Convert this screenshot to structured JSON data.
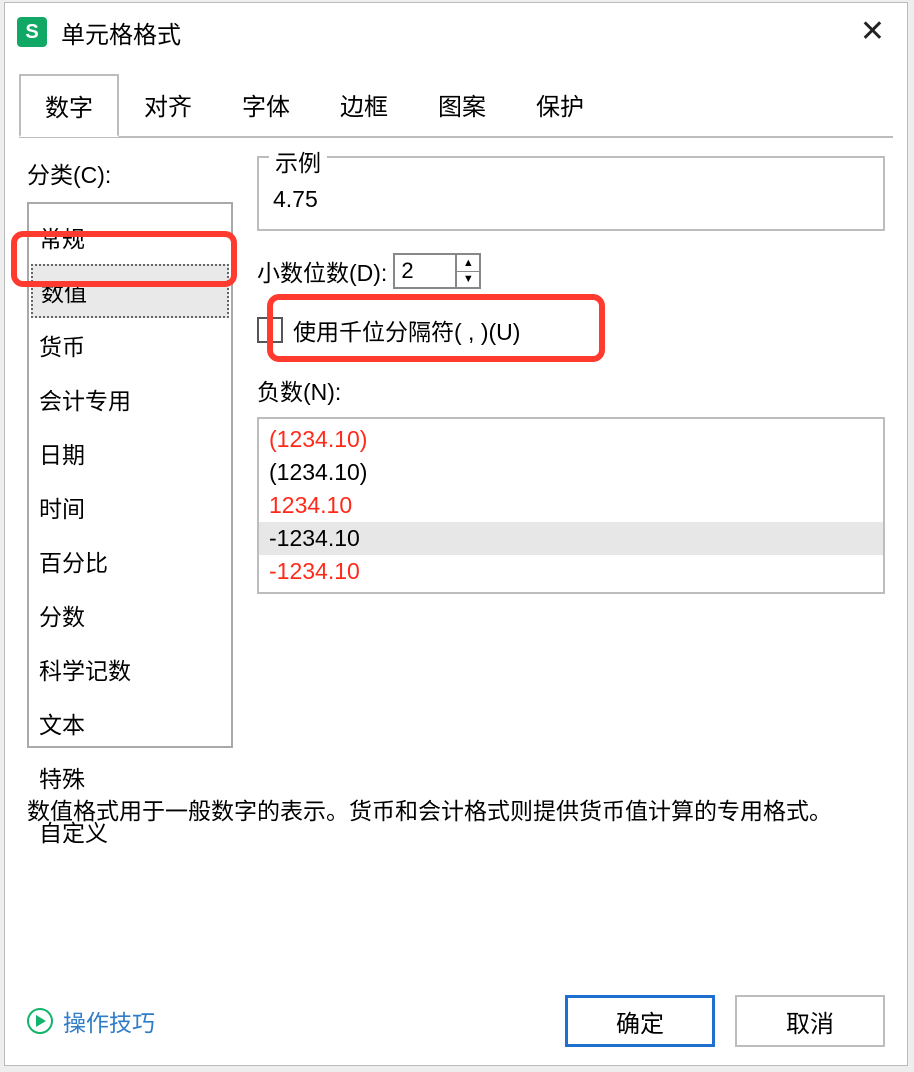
{
  "title": "单元格格式",
  "app_icon_letter": "S",
  "tabs": [
    "数字",
    "对齐",
    "字体",
    "边框",
    "图案",
    "保护"
  ],
  "category_label": "分类(C):",
  "categories": [
    "常规",
    "数值",
    "货币",
    "会计专用",
    "日期",
    "时间",
    "百分比",
    "分数",
    "科学记数",
    "文本",
    "特殊",
    "自定义"
  ],
  "selected_category_index": 1,
  "example": {
    "legend": "示例",
    "value": "4.75"
  },
  "decimal": {
    "label": "小数位数(D):",
    "value": "2"
  },
  "thousand_sep_label": "使用千位分隔符( , )(U)",
  "negative": {
    "label": "负数(N):",
    "items": [
      {
        "text": "(1234.10)",
        "red": true,
        "selected": false
      },
      {
        "text": "(1234.10)",
        "red": false,
        "selected": false
      },
      {
        "text": "1234.10",
        "red": true,
        "selected": false
      },
      {
        "text": "-1234.10",
        "red": false,
        "selected": true
      },
      {
        "text": "-1234.10",
        "red": true,
        "selected": false
      }
    ]
  },
  "description": "数值格式用于一般数字的表示。货币和会计格式则提供货币值计算的专用格式。",
  "footer": {
    "tips": "操作技巧",
    "ok": "确定",
    "cancel": "取消"
  }
}
